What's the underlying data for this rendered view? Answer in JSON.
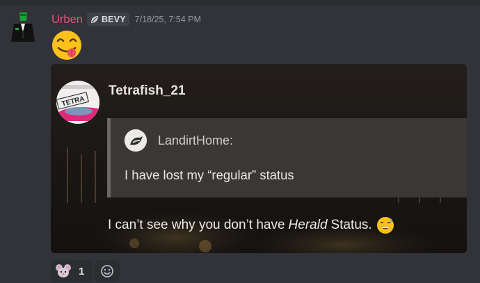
{
  "message": {
    "username": "Urben",
    "tag": "BEVY",
    "timestamp": "7/18/25, 7:54 PM",
    "big_emoji": "yum-face-emoji"
  },
  "embed": {
    "author": "Tetrafish_21",
    "avatar_text": "TETRA",
    "quote": {
      "author": "LandirtHome:",
      "text": "I have lost my “regular” status"
    },
    "body": {
      "before": "I can’t see why you don’t have",
      "italic": "Herald",
      "after": "Status."
    }
  },
  "reactions": [
    {
      "icon": "mouse-emoji",
      "count": "1"
    },
    {
      "icon": "add-reaction-icon"
    }
  ],
  "colors": {
    "background": "#313338",
    "username": "#e8507a"
  }
}
